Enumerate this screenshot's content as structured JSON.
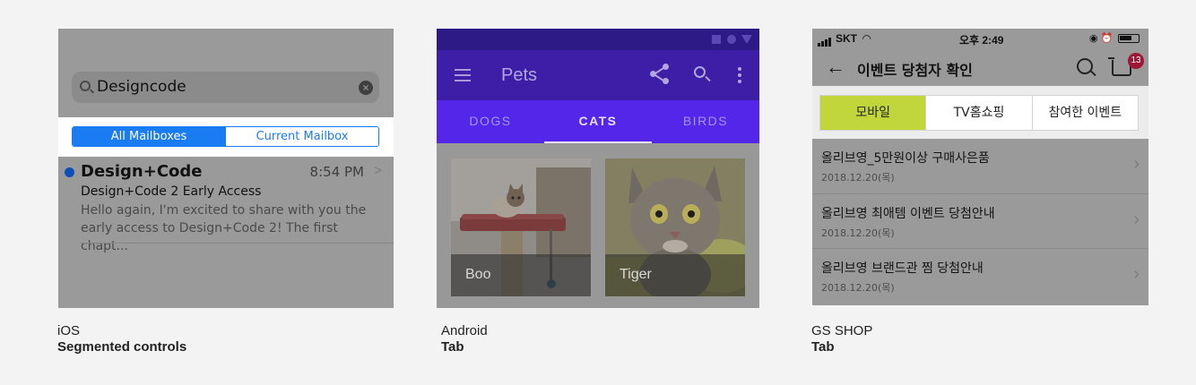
{
  "ios": {
    "search_value": "Designcode",
    "segments": [
      "All Mailboxes",
      "Current Mailbox"
    ],
    "mail": {
      "sender": "Design+Code",
      "time": "8:54 PM",
      "subject": "Design+Code 2 Early Access",
      "preview_line1": "Hello again, I'm excited to share with you the",
      "preview_line2": "early access to Design+Code 2! The first chapt..."
    },
    "caption_platform": "iOS",
    "caption_component": "Segmented controls"
  },
  "android": {
    "title": "Pets",
    "tabs": [
      "DOGS",
      "CATS",
      "BIRDS"
    ],
    "selected_tab": "CATS",
    "cards": [
      "Boo",
      "Tiger"
    ],
    "caption_platform": "Android",
    "caption_component": "Tab"
  },
  "gs": {
    "carrier": "SKT",
    "clock": "오후 2:49",
    "title": "이벤트 당첨자 확인",
    "cart_count": "13",
    "tabs": [
      "모바일",
      "TV홈쇼핑",
      "참여한 이벤트"
    ],
    "selected_tab": "모바일",
    "rows": [
      {
        "title": "올리브영_5만원이상 구매사은품",
        "date": "2018.12.20(목)"
      },
      {
        "title": "올리브영 최애템 이벤트 당첨안내",
        "date": "2018.12.20(목)"
      },
      {
        "title": "올리브영 브랜드관 찜 당첨안내",
        "date": "2018.12.20(목)"
      }
    ],
    "caption_platform": "GS SHOP",
    "caption_component": "Tab"
  },
  "colors": {
    "ios_accent": "#1a7cf3",
    "android_primary": "#3c1fa6",
    "android_tabs": "#5326ea",
    "gs_selected": "#c0d63b",
    "gs_badge": "#9e1736"
  }
}
